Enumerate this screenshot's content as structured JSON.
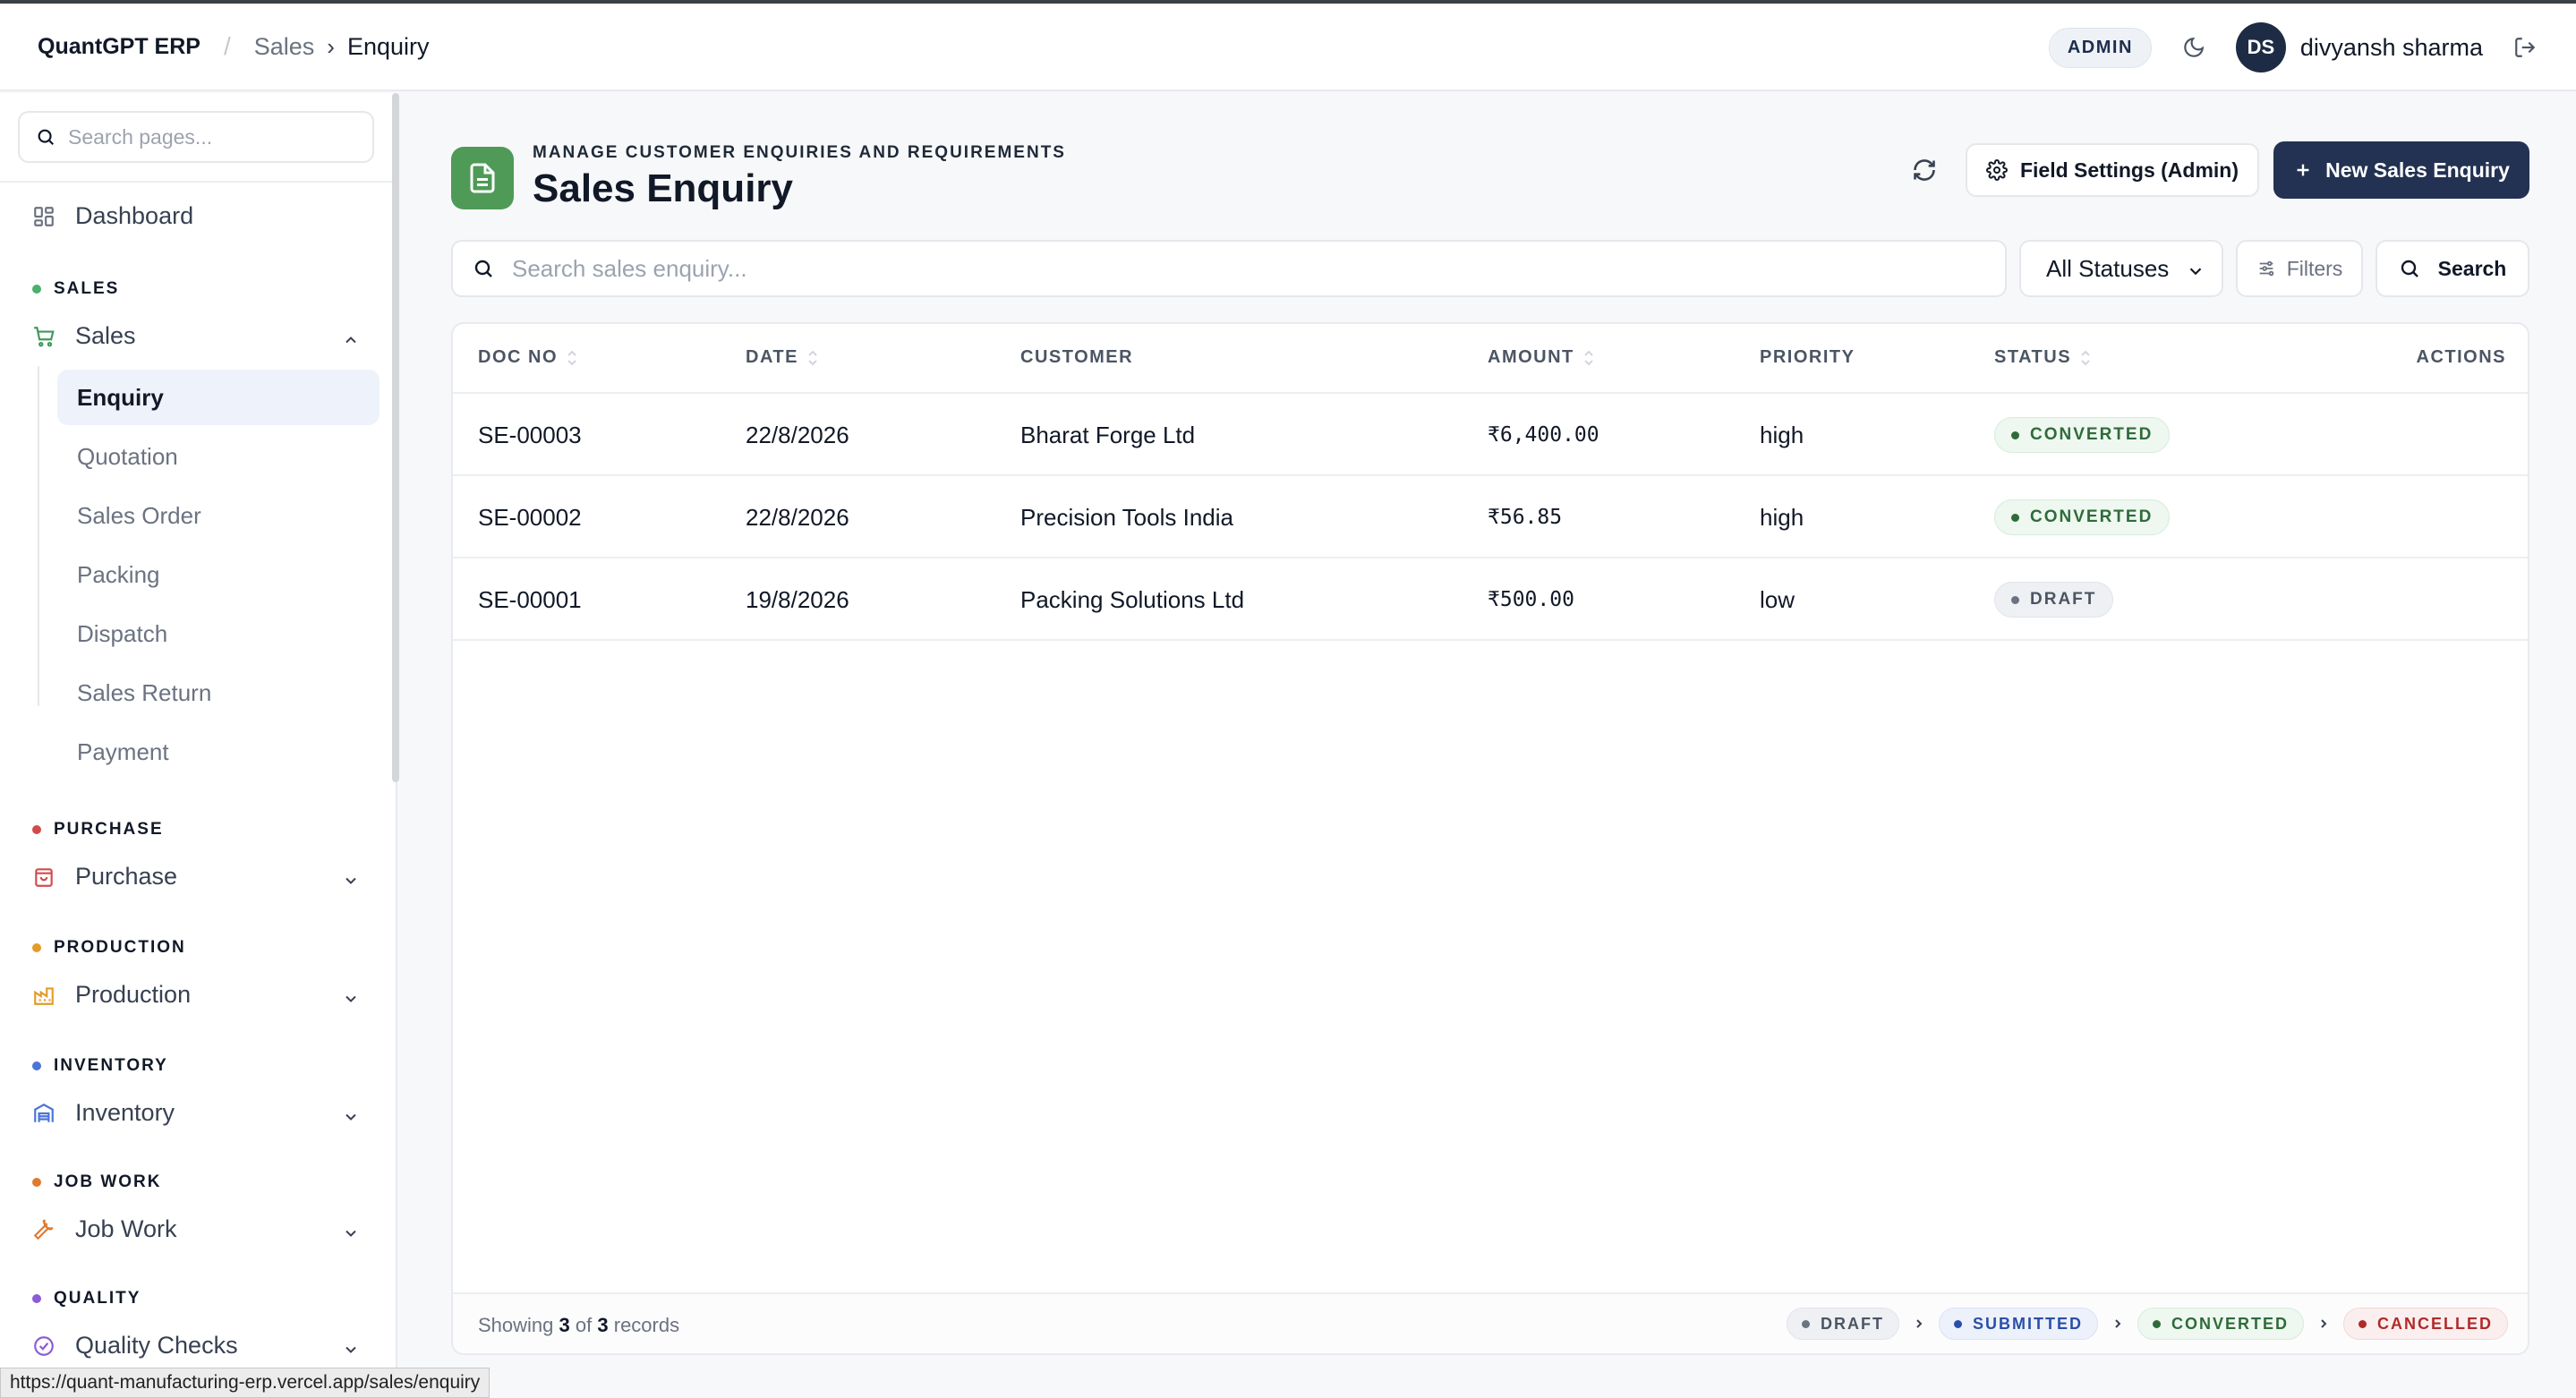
{
  "header": {
    "brand": "QuantGPT ERP",
    "breadcrumb": [
      "Sales",
      "Enquiry"
    ],
    "role_badge": "ADMIN",
    "avatar_initials": "DS",
    "user_name": "divyansh sharma"
  },
  "sidebar": {
    "search_placeholder": "Search pages...",
    "dashboard": "Dashboard",
    "sections": {
      "sales": {
        "label": "SALES",
        "item": "Sales",
        "color": "#4caf6a"
      },
      "purchase": {
        "label": "PURCHASE",
        "item": "Purchase",
        "color": "#d24b4b"
      },
      "production": {
        "label": "PRODUCTION",
        "item": "Production",
        "color": "#e39b2a"
      },
      "inventory": {
        "label": "INVENTORY",
        "item": "Inventory",
        "color": "#4a74d8"
      },
      "jobwork": {
        "label": "JOB WORK",
        "item": "Job Work",
        "color": "#e07a2f"
      },
      "quality": {
        "label": "QUALITY",
        "item": "Quality Checks",
        "color": "#8c5bd6"
      }
    },
    "sales_sub": [
      "Enquiry",
      "Quotation",
      "Sales Order",
      "Packing",
      "Dispatch",
      "Sales Return",
      "Payment"
    ]
  },
  "page": {
    "kicker": "MANAGE CUSTOMER ENQUIRIES AND REQUIREMENTS",
    "title": "Sales Enquiry",
    "field_settings_label": "Field Settings (Admin)",
    "new_label": "New Sales Enquiry",
    "search_placeholder": "Search sales enquiry...",
    "status_filter": "All Statuses",
    "filters_label": "Filters",
    "search_label": "Search"
  },
  "table": {
    "columns": {
      "doc_no": "DOC NO",
      "date": "DATE",
      "customer": "CUSTOMER",
      "amount": "AMOUNT",
      "priority": "PRIORITY",
      "status": "STATUS",
      "actions": "ACTIONS"
    },
    "rows": [
      {
        "doc_no": "SE-00003",
        "date": "22/8/2026",
        "customer": "Bharat Forge Ltd",
        "amount": "₹6,400.00",
        "priority": "high",
        "status": "CONVERTED"
      },
      {
        "doc_no": "SE-00002",
        "date": "22/8/2026",
        "customer": "Precision Tools India",
        "amount": "₹56.85",
        "priority": "high",
        "status": "CONVERTED"
      },
      {
        "doc_no": "SE-00001",
        "date": "19/8/2026",
        "customer": "Packing Solutions Ltd",
        "amount": "₹500.00",
        "priority": "low",
        "status": "DRAFT"
      }
    ],
    "footer": {
      "showing_prefix": "Showing",
      "shown": "3",
      "of": "of",
      "total": "3",
      "suffix": "records"
    },
    "status_flow": [
      "DRAFT",
      "SUBMITTED",
      "CONVERTED",
      "CANCELLED"
    ]
  },
  "status_bar_url": "https://quant-manufacturing-erp.vercel.app/sales/enquiry"
}
